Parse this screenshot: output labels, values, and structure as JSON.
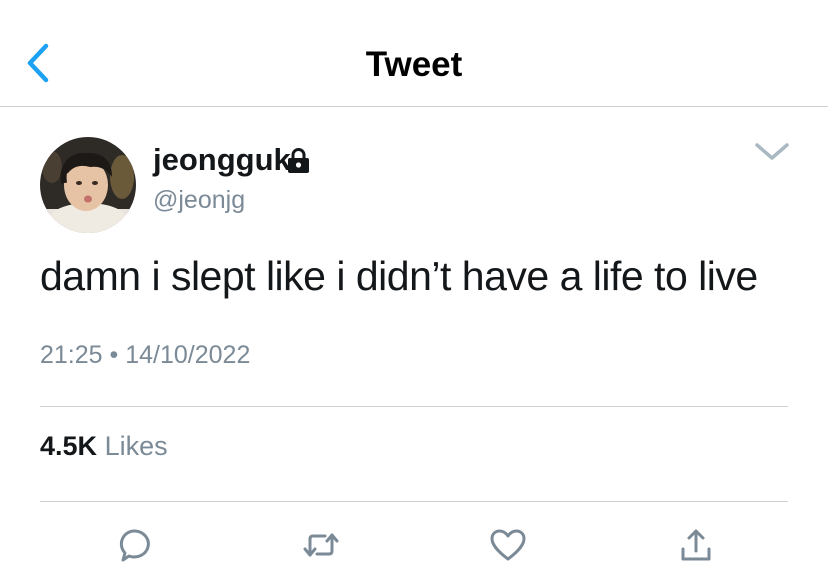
{
  "nav": {
    "title": "Tweet",
    "back_icon": "chevron-left-icon",
    "accent": "#1da1f2"
  },
  "tweet": {
    "author": {
      "display_name": "jeongguk",
      "handle": "@jeonjg",
      "protected": true
    },
    "text": "damn i slept like i didn’t have a life to live",
    "time": "21:25",
    "separator": "•",
    "date": "14/10/2022",
    "likes": {
      "count": "4.5K",
      "label": "Likes"
    }
  },
  "actions": [
    "reply-icon",
    "retweet-icon",
    "like-icon",
    "share-icon"
  ],
  "colors": {
    "text": "#14171a",
    "secondary": "#7b8a97",
    "divider": "#cdd2d6",
    "icon": "#7b8a97"
  }
}
